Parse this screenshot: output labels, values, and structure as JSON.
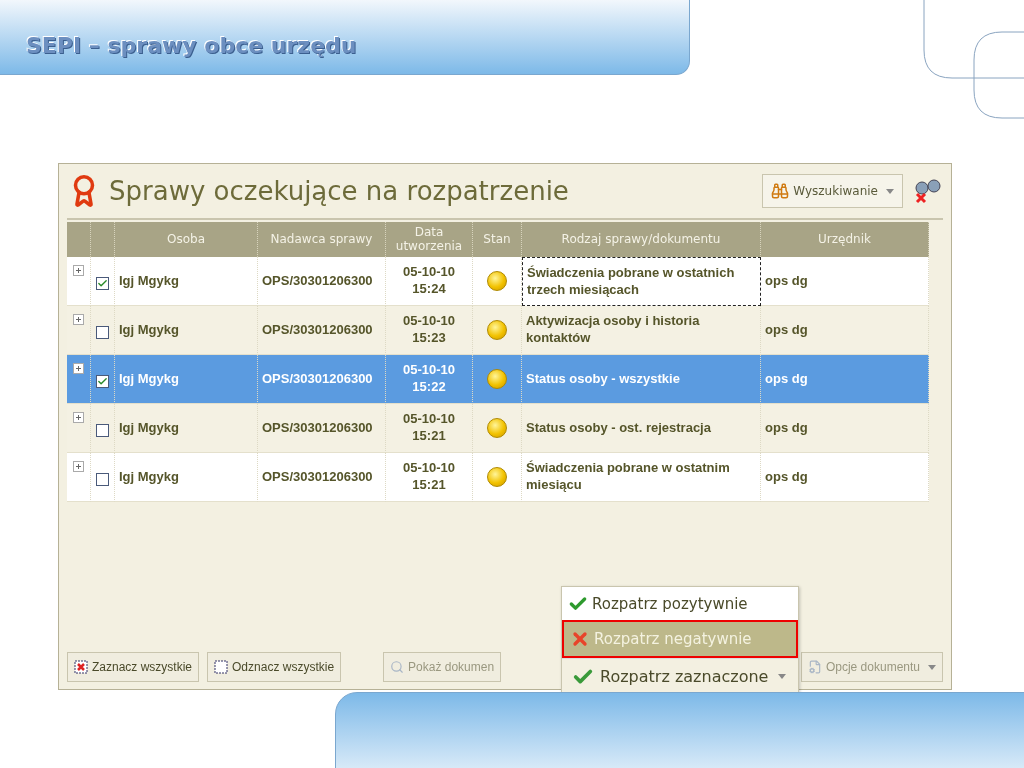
{
  "slide_title": "SEPI – sprawy obce urzędu",
  "panel": {
    "title": "Sprawy oczekujące na rozpatrzenie",
    "search_button": "Wyszukiwanie",
    "table": {
      "columns": [
        "Osoba",
        "Nadawca sprawy",
        "Data utworzenia",
        "Stan",
        "Rodzaj sprawy/dokumentu",
        "Urzędnik"
      ],
      "rows": [
        {
          "selected": false,
          "checked": true,
          "focused": true,
          "person": "Igj Mgykg",
          "sender": "OPS/30301206300",
          "created": "05-10-10\n15:24",
          "type": "Świadczenia pobrane w ostatnich trzech miesiącach",
          "clerk": "ops dg"
        },
        {
          "selected": false,
          "checked": false,
          "focused": false,
          "person": "Igj Mgykg",
          "sender": "OPS/30301206300",
          "created": "05-10-10\n15:23",
          "type": "Aktywizacja osoby i historia kontaktów",
          "clerk": "ops dg"
        },
        {
          "selected": true,
          "checked": true,
          "focused": false,
          "person": "Igj Mgykg",
          "sender": "OPS/30301206300",
          "created": "05-10-10\n15:22",
          "type": "Status osoby - wszystkie",
          "clerk": "ops dg"
        },
        {
          "selected": false,
          "checked": false,
          "focused": false,
          "person": "Igj Mgykg",
          "sender": "OPS/30301206300",
          "created": "05-10-10\n15:21",
          "type": "Status osoby - ost. rejestracja",
          "clerk": "ops dg"
        },
        {
          "selected": false,
          "checked": false,
          "focused": false,
          "person": "Igj Mgykg",
          "sender": "OPS/30301206300",
          "created": "05-10-10\n15:21",
          "type": "Świadczenia pobrane w ostatnim miesiącu",
          "clerk": "ops dg"
        }
      ]
    },
    "footer_buttons": [
      {
        "kind": "check-all",
        "label": "Zaznacz wszystkie",
        "disabled": false
      },
      {
        "kind": "uncheck-all",
        "label": "Odznacz wszystkie",
        "disabled": false
      },
      {
        "kind": "show",
        "label": "Pokaż dokumen",
        "disabled": true
      },
      {
        "kind": "options",
        "label": "Opcje dokumentu",
        "disabled": true
      }
    ],
    "menu": {
      "items": [
        {
          "kind": "positive",
          "label": "Rozpatrz pozytywnie",
          "selected": false
        },
        {
          "kind": "negative",
          "label": "Rozpatrz negatywnie",
          "selected": true
        }
      ],
      "button": "Rozpatrz zaznaczone"
    }
  }
}
